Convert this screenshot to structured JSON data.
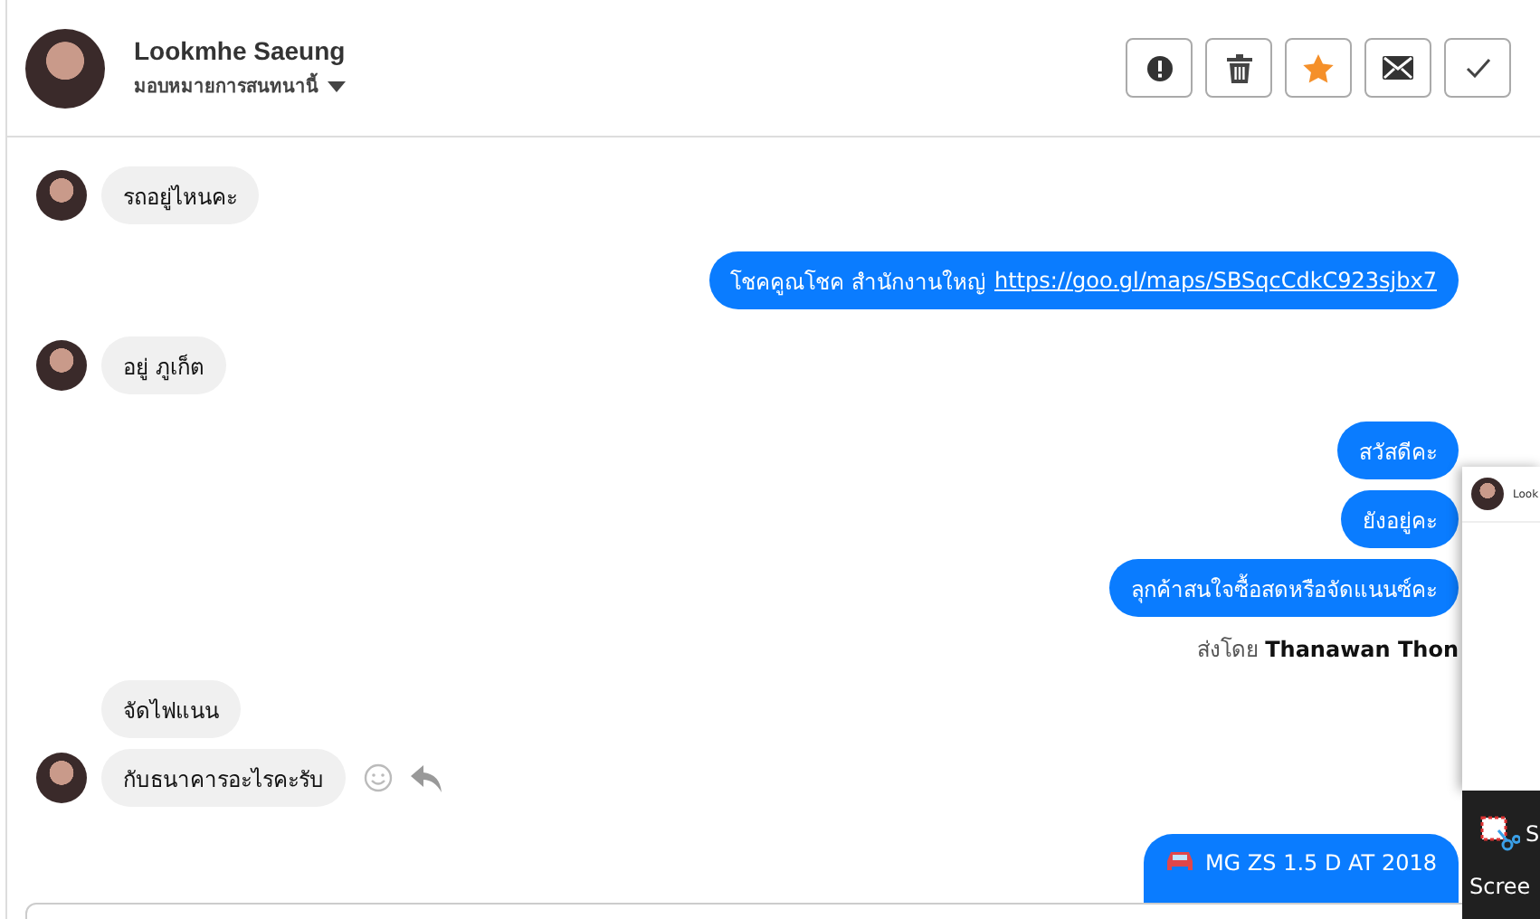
{
  "header": {
    "name": "Lookmhe Saeung",
    "assign_label": "มอบหมายการสนทนานี้"
  },
  "actions": [
    {
      "kind": "alert",
      "active": false
    },
    {
      "kind": "trash",
      "active": false
    },
    {
      "kind": "star",
      "active": true
    },
    {
      "kind": "mail",
      "active": false
    },
    {
      "kind": "check",
      "active": false
    }
  ],
  "messages": [
    {
      "kind": "incoming",
      "avatar": true,
      "text": "รถอยู่ไหนคะ"
    },
    {
      "kind": "outgoing",
      "text": "โชคคูณโชค สำนักงานใหญ่",
      "link": "https://goo.gl/maps/SBSqcCdkC923sjbx7"
    },
    {
      "kind": "incoming",
      "avatar": true,
      "text": "อยู่ ภูเก็ต"
    },
    {
      "kind": "outgoing",
      "text": "สวัสดีคะ"
    },
    {
      "kind": "outgoing",
      "text": "ยังอยู่คะ"
    },
    {
      "kind": "outgoing",
      "text": "ลุกค้าสนใจซื้อสดหรือจัดแนนซ์คะ"
    },
    {
      "kind": "note",
      "text": "ส่งโดย **Thanawan Thon**"
    },
    {
      "kind": "incoming",
      "avatar": false,
      "text": "จัดไฟแนน"
    },
    {
      "kind": "incoming",
      "avatar": true,
      "text": "กับธนาคารอะไรคะรับ",
      "reactions": true
    },
    {
      "kind": "car",
      "text": "MG ZS 1.5 D AT 2018"
    }
  ],
  "overlay": {
    "card_title": "Look",
    "taskbar_item": "S",
    "taskbar_label": "Scree"
  }
}
